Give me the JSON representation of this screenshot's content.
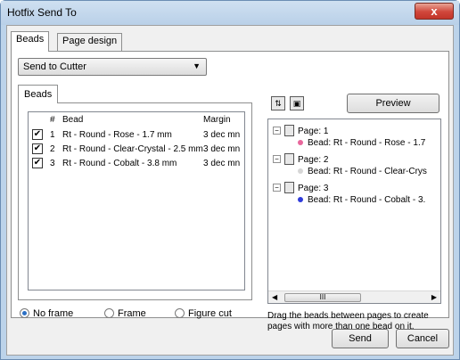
{
  "window": {
    "title": "Hotfix Send To",
    "close_glyph": "x"
  },
  "tabs": [
    {
      "label": "Beads"
    },
    {
      "label": "Page design"
    }
  ],
  "send_combo": {
    "value": "Send to Cutter"
  },
  "inner_tab": {
    "label": "Beads"
  },
  "bead_list": {
    "headers": {
      "num": "#",
      "bead": "Bead",
      "margin": "Margin"
    },
    "rows": [
      {
        "checked": true,
        "num": "1",
        "bead": "Rt - Round - Rose - 1.7 mm",
        "margin": "3 dec mn"
      },
      {
        "checked": true,
        "num": "2",
        "bead": "Rt - Round - Clear-Crystal - 2.5 mm",
        "margin": "3 dec mn"
      },
      {
        "checked": true,
        "num": "3",
        "bead": "Rt - Round - Cobalt - 3.8 mm",
        "margin": "3 dec mn"
      }
    ]
  },
  "frame_options": [
    {
      "label": "No frame",
      "selected": true
    },
    {
      "label": "Frame",
      "selected": false
    },
    {
      "label": "Figure cut",
      "selected": false
    }
  ],
  "preview_button": "Preview",
  "tree": {
    "pages": [
      {
        "label": "Page: 1",
        "bead": "Bead: Rt - Round - Rose - 1.7",
        "color": "#e8679c"
      },
      {
        "label": "Page: 2",
        "bead": "Bead: Rt - Round - Clear-Crys",
        "color": "#d6d6d6"
      },
      {
        "label": "Page: 3",
        "bead": "Bead: Rt - Round - Cobalt - 3.",
        "color": "#2f3bdb"
      }
    ],
    "scroll_thumb": "III"
  },
  "hint": "Drag the beads between pages to create pages with more than one bead on it.",
  "footer": {
    "send": "Send",
    "cancel": "Cancel"
  }
}
